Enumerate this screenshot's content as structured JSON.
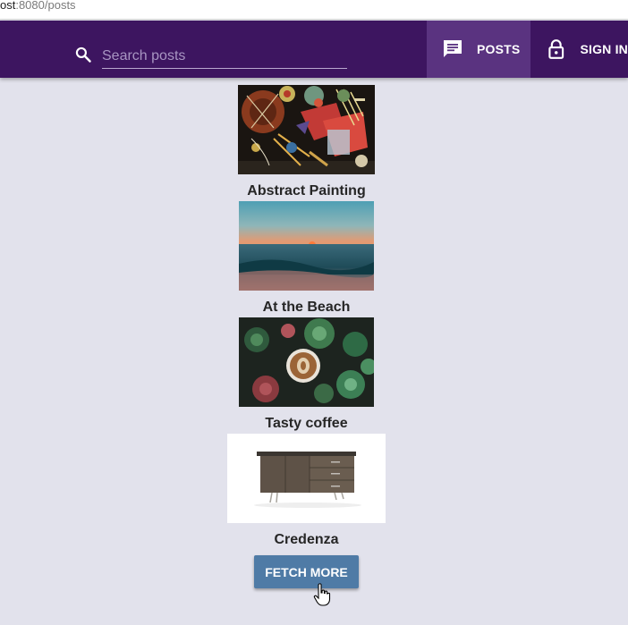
{
  "browser": {
    "url_host": "ost",
    "url_rest": ":8080/posts"
  },
  "appbar": {
    "background": "#3d1560",
    "search": {
      "icon": "search-icon",
      "placeholder": "Search posts",
      "value": ""
    },
    "nav": [
      {
        "label": "POSTS",
        "icon": "chat-bubble-icon",
        "active": true
      },
      {
        "label": "SIGN IN",
        "icon": "lock-icon",
        "active": false
      }
    ]
  },
  "posts": [
    {
      "title": "Abstract Painting",
      "image": "abstract-painting-image"
    },
    {
      "title": "At the Beach",
      "image": "beach-sunset-image"
    },
    {
      "title": "Tasty coffee",
      "image": "coffee-succulents-image"
    },
    {
      "title": "Credenza",
      "image": "credenza-furniture-image"
    }
  ],
  "fetch_more": {
    "label": "FETCH MORE",
    "color": "#4f7ba6"
  }
}
